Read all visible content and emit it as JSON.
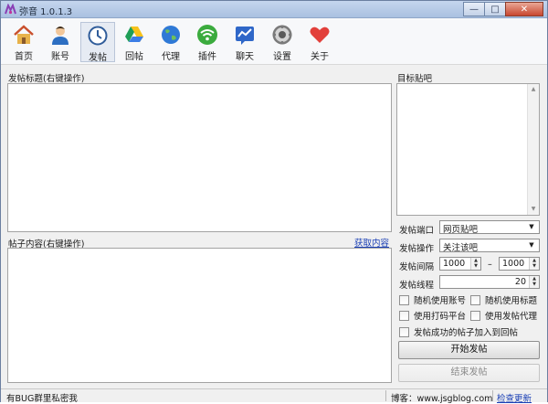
{
  "window": {
    "title": "弥音 1.0.1.3",
    "controls": {
      "minimize": "—",
      "maximize": "□",
      "close": "✕"
    }
  },
  "toolbar": {
    "items": [
      {
        "label": "首页",
        "icon": "home-icon"
      },
      {
        "label": "账号",
        "icon": "user-icon"
      },
      {
        "label": "发帖",
        "icon": "clock-icon",
        "active": true
      },
      {
        "label": "回帖",
        "icon": "drive-triangle-icon"
      },
      {
        "label": "代理",
        "icon": "globe-icon"
      },
      {
        "label": "插件",
        "icon": "wifi-icon"
      },
      {
        "label": "聊天",
        "icon": "chat-chart-icon"
      },
      {
        "label": "设置",
        "icon": "gear-icon"
      },
      {
        "label": "关于",
        "icon": "heart-icon"
      }
    ]
  },
  "left": {
    "title_label": "发帖标题(右键操作)",
    "content_label": "帖子内容(右键操作)",
    "fetch_link": "获取内容"
  },
  "right": {
    "target_label": "目标贴吧",
    "port_label": "发帖端口",
    "port_value": "网页贴吧",
    "action_label": "发帖操作",
    "action_value": "关注该吧",
    "interval_label": "发帖间隔",
    "interval_min": "1000",
    "interval_sep": "–",
    "interval_max": "1000",
    "threads_label": "发帖线程",
    "threads_value": "20",
    "options": {
      "random_account": "随机使用账号",
      "random_title": "随机使用标题",
      "use_captcha": "使用打码平台",
      "use_proxy": "使用发帖代理",
      "add_to_reply": "发帖成功的帖子加入到回帖"
    },
    "start_button": "开始发帖",
    "stop_button": "结束发帖"
  },
  "status": {
    "left_text": "有BUG群里私密我",
    "blog_text": "博客：www.jsgblog.com",
    "update_link": "检查更新"
  },
  "colors": {
    "titlebar": "#b6cae6",
    "window_bg": "#f0f0f0",
    "link": "#1a3fb5",
    "close_button": "#c8472f"
  }
}
